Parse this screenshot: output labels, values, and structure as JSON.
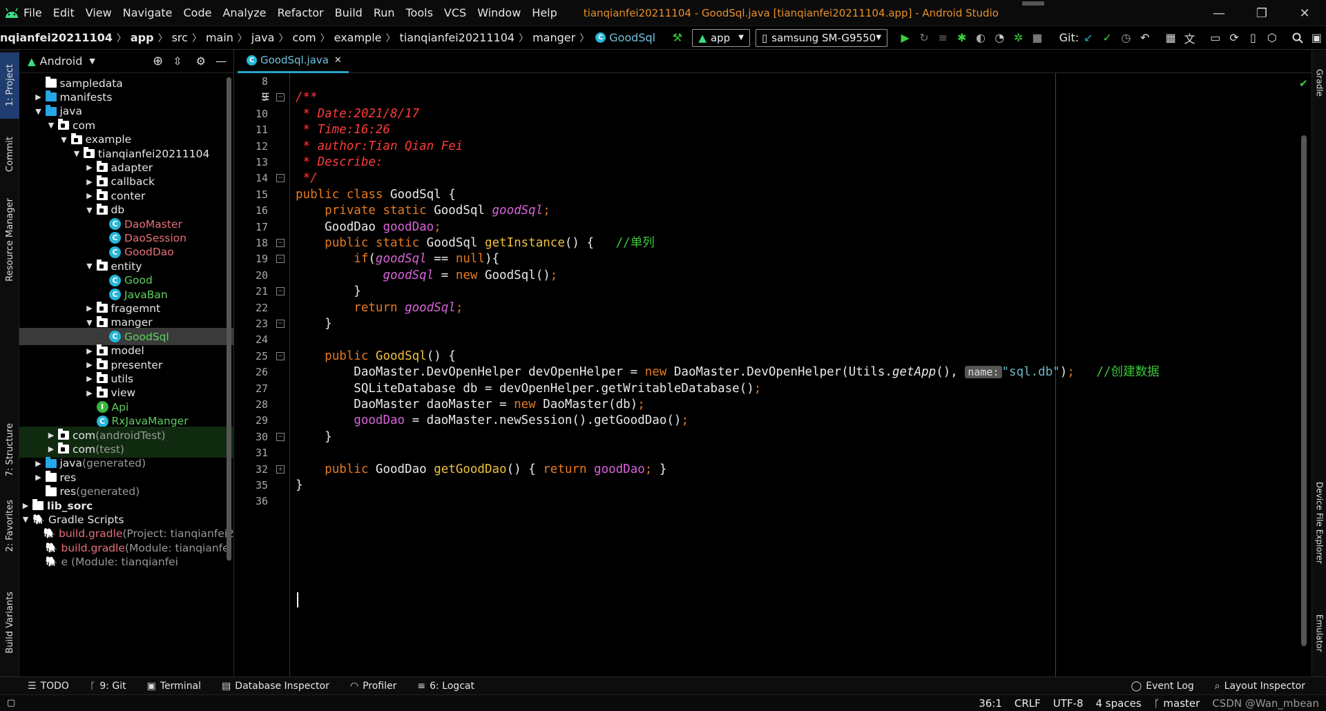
{
  "menubar": {
    "items": [
      "File",
      "Edit",
      "View",
      "Navigate",
      "Code",
      "Analyze",
      "Refactor",
      "Build",
      "Run",
      "Tools",
      "VCS",
      "Window",
      "Help"
    ],
    "window_title": "tianqianfei20211104 - GoodSql.java [tianqianfei20211104.app] - Android Studio"
  },
  "navbar": {
    "crumbs": [
      "nqianfei20211104",
      "app",
      "src",
      "main",
      "java",
      "com",
      "example",
      "tianqianfei20211104",
      "manger",
      "GoodSql"
    ],
    "run_config": "app",
    "device": "samsung SM-G9550",
    "git_label": "Git:"
  },
  "leftstripe": {
    "tabs": [
      "1: Project",
      "Commit",
      "Resource Manager",
      "7: Structure",
      "2: Favorites",
      "Build Variants"
    ]
  },
  "rightstripe": {
    "tabs": [
      "Gradle",
      "Device File Explorer",
      "Emulator"
    ]
  },
  "project": {
    "view_label": "Android",
    "tree": [
      {
        "label": "sampledata",
        "depth": 1,
        "arrow": "",
        "icon": "folder"
      },
      {
        "label": "manifests",
        "depth": 1,
        "arrow": "▶",
        "icon": "folder-blue"
      },
      {
        "label": "java",
        "depth": 1,
        "arrow": "▼",
        "icon": "folder-blue"
      },
      {
        "label": "com",
        "depth": 2,
        "arrow": "▼",
        "icon": "pkg"
      },
      {
        "label": "example",
        "depth": 3,
        "arrow": "▼",
        "icon": "pkg"
      },
      {
        "label": "tianqianfei20211104",
        "depth": 4,
        "arrow": "▼",
        "icon": "pkg"
      },
      {
        "label": "adapter",
        "depth": 5,
        "arrow": "▶",
        "icon": "pkg"
      },
      {
        "label": "callback",
        "depth": 5,
        "arrow": "▶",
        "icon": "pkg"
      },
      {
        "label": "conter",
        "depth": 5,
        "arrow": "▶",
        "icon": "pkg"
      },
      {
        "label": "db",
        "depth": 5,
        "arrow": "▼",
        "icon": "pkg"
      },
      {
        "label": "DaoMaster",
        "depth": 6,
        "arrow": "",
        "icon": "class",
        "color": "#e8707a"
      },
      {
        "label": "DaoSession",
        "depth": 6,
        "arrow": "",
        "icon": "class",
        "color": "#e8707a"
      },
      {
        "label": "GoodDao",
        "depth": 6,
        "arrow": "",
        "icon": "class",
        "color": "#e8707a"
      },
      {
        "label": "entity",
        "depth": 5,
        "arrow": "▼",
        "icon": "pkg"
      },
      {
        "label": "Good",
        "depth": 6,
        "arrow": "",
        "icon": "class",
        "color": "#5fd05f"
      },
      {
        "label": "JavaBan",
        "depth": 6,
        "arrow": "",
        "icon": "class",
        "color": "#5fd05f"
      },
      {
        "label": "fragemnt",
        "depth": 5,
        "arrow": "▶",
        "icon": "pkg"
      },
      {
        "label": "manger",
        "depth": 5,
        "arrow": "▼",
        "icon": "pkg"
      },
      {
        "label": "GoodSql",
        "depth": 6,
        "arrow": "",
        "icon": "class",
        "color": "#5fd05f",
        "selected": true
      },
      {
        "label": "model",
        "depth": 5,
        "arrow": "▶",
        "icon": "pkg"
      },
      {
        "label": "presenter",
        "depth": 5,
        "arrow": "▶",
        "icon": "pkg"
      },
      {
        "label": "utils",
        "depth": 5,
        "arrow": "▶",
        "icon": "pkg"
      },
      {
        "label": "view",
        "depth": 5,
        "arrow": "▶",
        "icon": "pkg"
      },
      {
        "label": "Api",
        "depth": 5,
        "arrow": "",
        "icon": "interface",
        "color": "#5fd05f"
      },
      {
        "label": "RxJavaManger",
        "depth": 5,
        "arrow": "",
        "icon": "class",
        "color": "#5fd05f"
      },
      {
        "label": "com",
        "suffix": " (androidTest)",
        "depth": 2,
        "arrow": "▶",
        "icon": "pkg",
        "bg": "#102a10"
      },
      {
        "label": "com",
        "suffix": " (test)",
        "depth": 2,
        "arrow": "▶",
        "icon": "pkg",
        "bg": "#102a10"
      },
      {
        "label": "java",
        "suffix": " (generated)",
        "depth": 1,
        "arrow": "▶",
        "icon": "folder-blue"
      },
      {
        "label": "res",
        "depth": 1,
        "arrow": "▶",
        "icon": "folder"
      },
      {
        "label": "res",
        "suffix": " (generated)",
        "depth": 1,
        "arrow": "",
        "icon": "folder"
      },
      {
        "label": "lib_sorc",
        "depth": 0,
        "arrow": "▶",
        "icon": "folder",
        "bold": true
      },
      {
        "label": "Gradle Scripts",
        "depth": 0,
        "arrow": "▼",
        "icon": "gradle"
      },
      {
        "label": "build.gradle",
        "suffix": " (Project: tianqianfei2",
        "depth": 1,
        "arrow": "",
        "icon": "gradle",
        "color": "#e8707a"
      },
      {
        "label": "build.gradle",
        "suffix": " (Module: tianqianfei",
        "depth": 1,
        "arrow": "",
        "icon": "gradle",
        "color": "#e8707a"
      },
      {
        "label": "",
        "suffix": "e (Module: tianqianfei",
        "depth": 1,
        "arrow": "",
        "icon": "gradle",
        "color": "#e8707a"
      }
    ]
  },
  "editor": {
    "tab_label": "GoodSql.java",
    "line_numbers": [
      "8",
      "9",
      "10",
      "11",
      "12",
      "13",
      "14",
      "15",
      "16",
      "17",
      "18",
      "19",
      "20",
      "21",
      "22",
      "23",
      "24",
      "25",
      "26",
      "27",
      "28",
      "29",
      "30",
      "31",
      "32",
      "35",
      "36"
    ],
    "lines": [
      [],
      [
        [
          "cm",
          "/**"
        ]
      ],
      [
        [
          "cm",
          " * Date:2021/8/17"
        ]
      ],
      [
        [
          "cm",
          " * Time:16:26"
        ]
      ],
      [
        [
          "cm",
          " * author:Tian Qian Fei"
        ]
      ],
      [
        [
          "cm",
          " * Describe:"
        ]
      ],
      [
        [
          "cm",
          " */"
        ]
      ],
      [
        [
          "kw",
          "public class "
        ],
        [
          "",
          "GoodSql {"
        ]
      ],
      [
        [
          "",
          "    "
        ],
        [
          "kw",
          "private static "
        ],
        [
          "",
          "GoodSql "
        ],
        [
          "fld",
          "goodSql"
        ],
        [
          "kw",
          ";"
        ]
      ],
      [
        [
          "",
          "    GoodDao "
        ],
        [
          "fld2",
          "goodDao"
        ],
        [
          "kw",
          ";"
        ]
      ],
      [
        [
          "",
          "    "
        ],
        [
          "kw",
          "public static "
        ],
        [
          "",
          "GoodSql "
        ],
        [
          "mt",
          "getInstance"
        ],
        [
          "",
          "() {   "
        ],
        [
          "cn",
          "//单列"
        ]
      ],
      [
        [
          "",
          "        "
        ],
        [
          "kw",
          "if"
        ],
        [
          "",
          "("
        ],
        [
          "fld",
          "goodSql"
        ],
        [
          "",
          " == "
        ],
        [
          "kw",
          "null"
        ],
        [
          "",
          "){"
        ]
      ],
      [
        [
          "",
          "            "
        ],
        [
          "fld",
          "goodSql"
        ],
        [
          "",
          " = "
        ],
        [
          "kw",
          "new "
        ],
        [
          "",
          "GoodSql()"
        ],
        [
          "kw",
          ";"
        ]
      ],
      [
        [
          "",
          "        }"
        ]
      ],
      [
        [
          "",
          "        "
        ],
        [
          "kw",
          "return "
        ],
        [
          "fld",
          "goodSql"
        ],
        [
          "kw",
          ";"
        ]
      ],
      [
        [
          "",
          "    }"
        ]
      ],
      [],
      [
        [
          "",
          "    "
        ],
        [
          "kw",
          "public "
        ],
        [
          "mt",
          "GoodSql"
        ],
        [
          "",
          "() {"
        ]
      ],
      [
        [
          "",
          "        DaoMaster.DevOpenHelper devOpenHelper = "
        ],
        [
          "kw",
          "new "
        ],
        [
          "",
          "DaoMaster.DevOpenHelper(Utils."
        ],
        [
          "it",
          "getApp"
        ],
        [
          "",
          "(), "
        ],
        [
          "hint",
          "name:"
        ],
        [
          "str",
          "\"sql.db\""
        ],
        [
          "",
          ")"
        ],
        [
          "kw",
          ";"
        ],
        [
          "",
          "   "
        ],
        [
          "cn",
          "//创建数据"
        ]
      ],
      [
        [
          "",
          "        SQLiteDatabase db = devOpenHelper.getWritableDatabase()"
        ],
        [
          "kw",
          ";"
        ]
      ],
      [
        [
          "",
          "        DaoMaster daoMaster = "
        ],
        [
          "kw",
          "new "
        ],
        [
          "",
          "DaoMaster(db)"
        ],
        [
          "kw",
          ";"
        ]
      ],
      [
        [
          "",
          "        "
        ],
        [
          "fld2",
          "goodDao"
        ],
        [
          "",
          " = daoMaster.newSession().getGoodDao()"
        ],
        [
          "kw",
          ";"
        ]
      ],
      [
        [
          "",
          "    }"
        ]
      ],
      [],
      [
        [
          "",
          "    "
        ],
        [
          "kw",
          "public "
        ],
        [
          "",
          "GoodDao "
        ],
        [
          "mt",
          "getGoodDao"
        ],
        [
          "",
          "() { "
        ],
        [
          "kw",
          "return "
        ],
        [
          "fld2",
          "goodDao"
        ],
        [
          "kw",
          ";"
        ],
        [
          "",
          " }"
        ]
      ],
      [
        [
          "",
          "}"
        ]
      ],
      []
    ]
  },
  "bottombar": {
    "left": [
      "TODO",
      "9: Git",
      "Terminal",
      "Database Inspector",
      "Profiler",
      "6: Logcat"
    ],
    "right": [
      "Event Log",
      "Layout Inspector"
    ]
  },
  "statusbar": {
    "position": "36:1",
    "line_sep": "CRLF",
    "encoding": "UTF-8",
    "indent": "4 spaces",
    "branch": "master",
    "watermark": "CSDN @Wan_mbean"
  },
  "colors": {
    "accent": "#2aa3c9",
    "keyword": "#e77a1f",
    "comment": "#ff3b3b",
    "field": "#d764d9",
    "method": "#f0c13b",
    "title": "#e8902a"
  }
}
